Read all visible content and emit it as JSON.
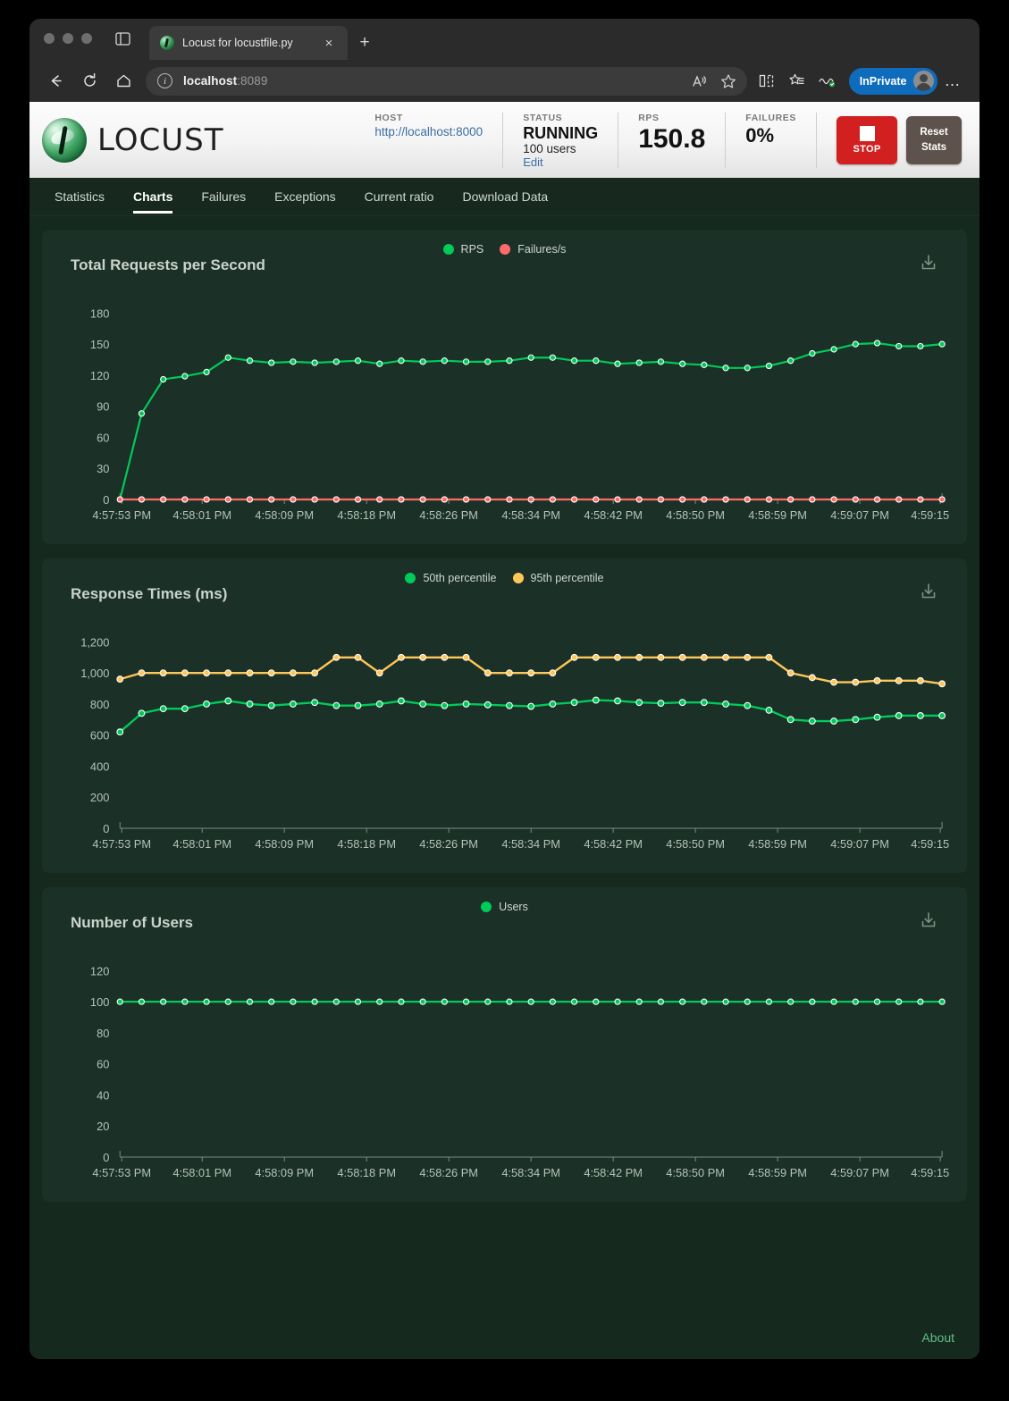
{
  "browser": {
    "tab_title": "Locust for locustfile.py",
    "tab_favicon": "locust-favicon",
    "new_tab_label": "+",
    "close_label": "×",
    "url_bold": "localhost",
    "url_rest": ":8089",
    "inprivate_label": "InPrivate",
    "overflow_label": "…"
  },
  "header": {
    "brand": "LOCUST",
    "host_label": "HOST",
    "host_value": "http://localhost:8000",
    "status_label": "STATUS",
    "status_value": "RUNNING",
    "users_value": "100 users",
    "edit_label": "Edit",
    "rps_label": "RPS",
    "rps_value": "150.8",
    "failures_label": "FAILURES",
    "failures_value": "0%",
    "stop_label": "STOP",
    "reset_label": "Reset Stats"
  },
  "nav": {
    "tabs": [
      {
        "label": "Statistics",
        "active": false
      },
      {
        "label": "Charts",
        "active": true
      },
      {
        "label": "Failures",
        "active": false
      },
      {
        "label": "Exceptions",
        "active": false
      },
      {
        "label": "Current ratio",
        "active": false
      },
      {
        "label": "Download Data",
        "active": false
      }
    ]
  },
  "footer": {
    "about_label": "About"
  },
  "colors": {
    "rps_green": "#00ca5a",
    "failures_red": "#ff6b6b",
    "p50_green": "#00ca5a",
    "p95_orange": "#ffc658",
    "users_green": "#00ca5a",
    "page_bg": "#16291f",
    "card_bg": "#1b3026",
    "accent_link": "#5fbf86"
  },
  "chart_data": [
    {
      "type": "line",
      "title": "Total Requests per Second",
      "xlabel": "",
      "ylabel": "",
      "ylim": [
        0,
        195
      ],
      "yticks": [
        0,
        30,
        60,
        90,
        120,
        150,
        180
      ],
      "grid": false,
      "legend_position": "top-center",
      "xticklabels": [
        "4:57:53 PM",
        "4:58:01 PM",
        "4:58:09 PM",
        "4:58:18 PM",
        "4:58:26 PM",
        "4:58:34 PM",
        "4:58:42 PM",
        "4:58:50 PM",
        "4:58:59 PM",
        "4:59:07 PM",
        "4:59:15 PM"
      ],
      "series": [
        {
          "name": "RPS",
          "color": "#00ca5a",
          "values": [
            0,
            83,
            116,
            119,
            123,
            137,
            134,
            132,
            133,
            132,
            133,
            134,
            131,
            134,
            133,
            134,
            133,
            133,
            134,
            137,
            137,
            134,
            134,
            131,
            132,
            133,
            131,
            130,
            127,
            127,
            129,
            134,
            141,
            145,
            150,
            151,
            148,
            148,
            150
          ]
        },
        {
          "name": "Failures/s",
          "color": "#ff6b6b",
          "values": [
            0,
            0,
            0,
            0,
            0,
            0,
            0,
            0,
            0,
            0,
            0,
            0,
            0,
            0,
            0,
            0,
            0,
            0,
            0,
            0,
            0,
            0,
            0,
            0,
            0,
            0,
            0,
            0,
            0,
            0,
            0,
            0,
            0,
            0,
            0,
            0,
            0,
            0,
            0
          ]
        }
      ]
    },
    {
      "type": "line",
      "title": "Response Times (ms)",
      "xlabel": "",
      "ylabel": "",
      "ylim": [
        0,
        1300
      ],
      "yticks": [
        0,
        200,
        400,
        600,
        800,
        1000,
        1200
      ],
      "yticklabels": [
        "0",
        "200",
        "400",
        "600",
        "800",
        "1,000",
        "1,200"
      ],
      "grid": false,
      "legend_position": "top-center",
      "xticklabels": [
        "4:57:53 PM",
        "4:58:01 PM",
        "4:58:09 PM",
        "4:58:18 PM",
        "4:58:26 PM",
        "4:58:34 PM",
        "4:58:42 PM",
        "4:58:50 PM",
        "4:58:59 PM",
        "4:59:07 PM",
        "4:59:15 PM"
      ],
      "series": [
        {
          "name": "50th percentile",
          "color": "#00ca5a",
          "values": [
            620,
            740,
            770,
            770,
            800,
            820,
            800,
            790,
            800,
            810,
            790,
            790,
            800,
            820,
            800,
            790,
            800,
            795,
            790,
            785,
            800,
            810,
            825,
            820,
            810,
            805,
            810,
            810,
            800,
            790,
            760,
            700,
            690,
            690,
            700,
            715,
            725,
            725,
            725
          ]
        },
        {
          "name": "95th percentile",
          "color": "#ffc658",
          "values": [
            960,
            1000,
            1000,
            1000,
            1000,
            1000,
            1000,
            1000,
            1000,
            1000,
            1100,
            1100,
            1000,
            1100,
            1100,
            1100,
            1100,
            1000,
            1000,
            1000,
            1000,
            1100,
            1100,
            1100,
            1100,
            1100,
            1100,
            1100,
            1100,
            1100,
            1100,
            1000,
            970,
            940,
            940,
            950,
            950,
            950,
            930
          ]
        }
      ]
    },
    {
      "type": "line",
      "title": "Number of Users",
      "xlabel": "",
      "ylabel": "",
      "ylim": [
        0,
        130
      ],
      "yticks": [
        0,
        20,
        40,
        60,
        80,
        100,
        120
      ],
      "grid": false,
      "legend_position": "top-center",
      "xticklabels": [
        "4:57:53 PM",
        "4:58:01 PM",
        "4:58:09 PM",
        "4:58:18 PM",
        "4:58:26 PM",
        "4:58:34 PM",
        "4:58:42 PM",
        "4:58:50 PM",
        "4:58:59 PM",
        "4:59:07 PM",
        "4:59:15 PM"
      ],
      "series": [
        {
          "name": "Users",
          "color": "#00ca5a",
          "values": [
            100,
            100,
            100,
            100,
            100,
            100,
            100,
            100,
            100,
            100,
            100,
            100,
            100,
            100,
            100,
            100,
            100,
            100,
            100,
            100,
            100,
            100,
            100,
            100,
            100,
            100,
            100,
            100,
            100,
            100,
            100,
            100,
            100,
            100,
            100,
            100,
            100,
            100,
            100
          ]
        }
      ]
    }
  ]
}
